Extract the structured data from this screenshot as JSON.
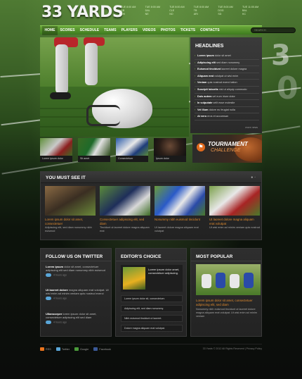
{
  "header": {
    "logo": "33 YARDS",
    "scores": [
      {
        "line1": "TUE 8:00 AM",
        "line2": "GB",
        "line3": "CHI"
      },
      {
        "line1": "TUE 8:00 AM",
        "line2": "DAL",
        "line3": "NE"
      },
      {
        "line1": "TUE 8:00 AM",
        "line2": "CLE",
        "line3": "NO"
      },
      {
        "line1": "TUE 8:00 AM",
        "line2": "TB",
        "line3": "ARI"
      },
      {
        "line1": "TUE 8:00 AM",
        "line2": "DOG",
        "line3": "SD"
      },
      {
        "line1": "TUE 11:00 AM",
        "line2": "BAL",
        "line3": "KC"
      }
    ]
  },
  "nav": {
    "items": [
      "HOME",
      "SCORES",
      "SCHEDULE",
      "TEAMS",
      "PLAYERS",
      "VIDEOS",
      "PHOTOS",
      "TICKETS",
      "CONTACTS"
    ],
    "search_placeholder": "SEARCH"
  },
  "headlines": {
    "title": "HEADLINES",
    "items": [
      {
        "bold": "Lorem ipsum",
        "rest": " dolor sit amet"
      },
      {
        "bold": "Adipiscing elit",
        "rest": " sed diam nonummy"
      },
      {
        "bold": "Euismod tincidunt",
        "rest": " laoreet dolore magna"
      },
      {
        "bold": "Aliquam erat",
        "rest": " volutpat ut wisi enim"
      },
      {
        "bold": "Veniam",
        "rest": " quis nostrud exerci tation"
      },
      {
        "bold": "Suscipit lobortis",
        "rest": " nisl ut aliquip commodo"
      },
      {
        "bold": "Duis autem",
        "rest": " vel eum iriure dolor"
      },
      {
        "bold": "In vulputate",
        "rest": " velit esse molestie"
      },
      {
        "bold": "Vel illum",
        "rest": " dolore eu feugiat nulla"
      },
      {
        "bold": "At vero",
        "rest": " eros et accumsan"
      }
    ],
    "more": "more news"
  },
  "thumbs": [
    {
      "caption": "Lorem ipsum dolor"
    },
    {
      "caption": "Sit amet"
    },
    {
      "caption": "Consectetuer"
    },
    {
      "caption": "Ipsum dolor"
    }
  ],
  "tournament": {
    "title": "TOURNAMENT",
    "subtitle": "CHALLENGE"
  },
  "must_see": {
    "title": "YOU MUST SEE IT",
    "items": [
      {
        "headline": "Lorem ipsum dolor sit amet, consectetuer",
        "text": "Adipiscing elit, sed diam nonummy nibh euismod"
      },
      {
        "headline": "Consectetuer adipiscing elit, sed diam",
        "text": "Tincidunt ut laoreet dolore magna aliquam erat"
      },
      {
        "headline": "Nonummy nibh euismod tincidunt",
        "text": "Ut laoreet dolore magna aliquam erat volutpat"
      },
      {
        "headline": "Ut laoreet dolore magna aliquam erat volutpat",
        "text": "Ut wisi enim ad minim veniam quis nostrud"
      }
    ]
  },
  "twitter": {
    "title": "FOLLOW US ON TWITTER",
    "tweets": [
      {
        "bold": "Lorem ipsum",
        "text": " dolor sit amet, consectetuer adipiscing elit sed diam nonummy nibh euismod",
        "ago": "4 hours ago"
      },
      {
        "bold": "Ut laoreet dolore",
        "text": " magna aliquam erat volutpat. Ut wisi enim ad minim veniam quis nostrud exerci",
        "ago": "4 hours ago"
      },
      {
        "bold": "Ullamcorper",
        "text": " lorem ipsum dolor sit amet, consectetuer adipiscing elit sed diam",
        "ago": "4 hours ago"
      }
    ]
  },
  "editors_choice": {
    "title": "EDITOR'S CHOICE",
    "feature": "Lorem ipsum dolor amet, consectetuer adipiscing.",
    "rows": [
      "Lorem ipsum dolor sit, consectetuer.",
      "Adipiscing elit, sed diam nonummy.",
      "Nibh euismod tincidunt ut laoreet.",
      "Dolore magna aliquam erat volutpat."
    ]
  },
  "most_popular": {
    "title": "MOST POPULAR",
    "headline": "Lorem ipsum dolor sit amet, consectetuer adipiscing elit, sed diam",
    "text": "Nonummy nibh euismod tincidunt ut laoreet dolore magna aliquam erat volutpat. Ut wisi enim ad minim veniam"
  },
  "footer": {
    "social": [
      "RSS",
      "Twitter",
      "Google",
      "Facebook"
    ],
    "copyright": "33 Yards © 2012 All Rights Reserved  |  Privacy Policy"
  }
}
